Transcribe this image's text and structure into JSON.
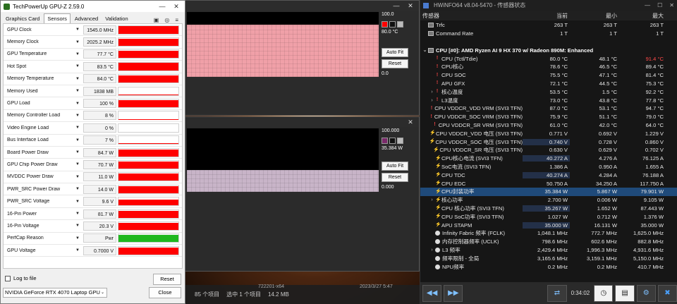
{
  "gpuz": {
    "title": "TechPowerUp GPU-Z 2.59.0",
    "tabs": [
      "Graphics Card",
      "Sensors",
      "Advanced",
      "Validation"
    ],
    "sensors": [
      {
        "name": "GPU Clock",
        "value": "1545.0 MHz",
        "level": 0.95,
        "color": "#ff0000"
      },
      {
        "name": "Memory Clock",
        "value": "2025.2 MHz",
        "level": 0.95,
        "color": "#ff0000"
      },
      {
        "name": "GPU Temperature",
        "value": "77.7 °C",
        "level": 0.95,
        "color": "#ff0000"
      },
      {
        "name": "Hot Spot",
        "value": "83.5 °C",
        "level": 0.95,
        "color": "#ff0000"
      },
      {
        "name": "Memory Temperature",
        "value": "84.0 °C",
        "level": 0.95,
        "color": "#ff0000"
      },
      {
        "name": "Memory Used",
        "value": "1838 MB",
        "level": 0.1,
        "color": "#ff0000"
      },
      {
        "name": "GPU Load",
        "value": "100 %",
        "level": 0.95,
        "color": "#ff0000"
      },
      {
        "name": "Memory Controller Load",
        "value": "8 %",
        "level": 0.08,
        "color": "#ff0000"
      },
      {
        "name": "Video Engine Load",
        "value": "0 %",
        "level": 0.0,
        "color": "#ff0000"
      },
      {
        "name": "Bus Interface Load",
        "value": "7 %",
        "level": 0.07,
        "color": "#ff0000"
      },
      {
        "name": "Board Power Draw",
        "value": "84.7 W",
        "level": 0.9,
        "color": "#ff0000"
      },
      {
        "name": "GPU Chip Power Draw",
        "value": "70.7 W",
        "level": 0.9,
        "color": "#ff0000"
      },
      {
        "name": "MVDDC Power Draw",
        "value": "11.0 W",
        "level": 0.9,
        "color": "#ff0000"
      },
      {
        "name": "PWR_SRC Power Draw",
        "value": "14.0 W",
        "level": 0.9,
        "color": "#ff0000"
      },
      {
        "name": "PWR_SRC Voltage",
        "value": "9.6 V",
        "level": 0.75,
        "color": "#ff0000"
      },
      {
        "name": "16-Pin Power",
        "value": "81.7 W",
        "level": 0.9,
        "color": "#ff0000"
      },
      {
        "name": "16-Pin Voltage",
        "value": "20.3 V",
        "level": 0.9,
        "color": "#ff0000"
      },
      {
        "name": "PerfCap Reason",
        "value": "Pwr",
        "level": 0.95,
        "color": "#1fb81f"
      },
      {
        "name": "GPU Voltage",
        "value": "0.7000 V",
        "level": 0.9,
        "color": "#ff0000"
      }
    ],
    "log_to_file": "Log to file",
    "reset": "Reset",
    "gpu_select": "NVIDIA GeForce RTX 4070 Laptop GPU",
    "close": "Close"
  },
  "graph1": {
    "max_label": "100.0",
    "cur_label": "80.0 °C",
    "min_label": "0.0",
    "auto_fit": "Auto Fit",
    "reset": "Reset",
    "fill_color": "#f0a0a8",
    "level": 0.8
  },
  "graph2": {
    "max_label": "100.000",
    "cur_label": "35.384 W",
    "min_label": "0.000",
    "auto_fit": "Auto Fit",
    "reset": "Reset",
    "fill_color": "#c8b4c8",
    "level": 0.35
  },
  "explorer": {
    "item_count": "85 个项目",
    "selection": "选中 1 个项目",
    "size": "14.2 MB",
    "filename": "722201-x64",
    "date": "2023/3/27 5:47"
  },
  "hwinfo": {
    "title": "HWiNFO64 v8.04-5470 - 传感器状态",
    "col_sensor": "传感器",
    "col_current": "当前",
    "col_min": "最小",
    "col_max": "最大",
    "rows": [
      {
        "icon": "chip",
        "exp": "",
        "indent": 0,
        "name": "Trfc",
        "cur": "263 T",
        "min": "263 T",
        "max": "263 T"
      },
      {
        "icon": "chip",
        "exp": "",
        "indent": 0,
        "name": "Command Rate",
        "cur": "1 T",
        "min": "1 T",
        "max": "1 T"
      },
      {
        "icon": "",
        "exp": "",
        "indent": 0,
        "name": "",
        "cur": "",
        "min": "",
        "max": ""
      },
      {
        "icon": "chip",
        "exp": "v",
        "indent": 0,
        "name": "CPU [#0]: AMD Ryzen AI 9 HX 370 w/ Radeon 890M: Enhanced",
        "cur": "",
        "min": "",
        "max": "",
        "group": true
      },
      {
        "icon": "temp",
        "exp": "",
        "indent": 1,
        "name": "CPU (Tctl/Tdie)",
        "cur": "80.0 °C",
        "min": "48.1 °C",
        "max": "91.4 °C",
        "maxred": true
      },
      {
        "icon": "temp",
        "exp": "",
        "indent": 1,
        "name": "CPU核心",
        "cur": "78.6 °C",
        "min": "46.5 °C",
        "max": "89.4 °C"
      },
      {
        "icon": "temp",
        "exp": "",
        "indent": 1,
        "name": "CPU SOC",
        "cur": "75.5 °C",
        "min": "47.1 °C",
        "max": "81.4 °C"
      },
      {
        "icon": "temp",
        "exp": "",
        "indent": 1,
        "name": "APU GFX",
        "cur": "72.1 °C",
        "min": "44.5 °C",
        "max": "75.3 °C"
      },
      {
        "icon": "temp",
        "exp": ">",
        "indent": 1,
        "name": "核心温度",
        "cur": "53.5 °C",
        "min": "1.5 °C",
        "max": "92.2 °C"
      },
      {
        "icon": "temp",
        "exp": ">",
        "indent": 1,
        "name": "L3温度",
        "cur": "73.0 °C",
        "min": "43.8 °C",
        "max": "77.8 °C"
      },
      {
        "icon": "temp",
        "exp": "",
        "indent": 1,
        "name": "CPU VDDCR_VDD VRM (SVI3 TFN)",
        "cur": "87.0 °C",
        "min": "53.1 °C",
        "max": "94.7 °C"
      },
      {
        "icon": "temp",
        "exp": "",
        "indent": 1,
        "name": "CPU VDDCR_SOC VRM (SVI3 TFN)",
        "cur": "75.9 °C",
        "min": "51.1 °C",
        "max": "79.0 °C"
      },
      {
        "icon": "temp",
        "exp": "",
        "indent": 1,
        "name": "CPU VDDCR_SR VRM (SVI3 TFN)",
        "cur": "61.0 °C",
        "min": "42.0 °C",
        "max": "64.0 °C"
      },
      {
        "icon": "volt",
        "exp": "",
        "indent": 1,
        "name": "CPU VDDCR_VDD 电压 (SVI3 TFN)",
        "cur": "0.771 V",
        "min": "0.692 V",
        "max": "1.229 V"
      },
      {
        "icon": "volt",
        "exp": "",
        "indent": 1,
        "name": "CPU VDDCR_SOC 电压 (SVI3 TFN)",
        "cur": "0.740 V",
        "min": "0.728 V",
        "max": "0.860 V",
        "shade": true
      },
      {
        "icon": "volt",
        "exp": "",
        "indent": 1,
        "name": "CPU VDDCR_SR 电压 (SVI3 TFN)",
        "cur": "0.630 V",
        "min": "0.629 V",
        "max": "0.702 V"
      },
      {
        "icon": "volt",
        "exp": "",
        "indent": 1,
        "name": "CPU核心电流 (SVI3 TFN)",
        "cur": "40.272 A",
        "min": "4.276 A",
        "max": "76.125 A",
        "shade": true
      },
      {
        "icon": "volt",
        "exp": "",
        "indent": 1,
        "name": "SoC电流 (SVI3 TFN)",
        "cur": "1.386 A",
        "min": "0.950 A",
        "max": "1.655 A"
      },
      {
        "icon": "volt",
        "exp": "",
        "indent": 1,
        "name": "CPU TDC",
        "cur": "40.274 A",
        "min": "4.284 A",
        "max": "76.188 A",
        "shade": true
      },
      {
        "icon": "volt",
        "exp": "",
        "indent": 1,
        "name": "CPU EDC",
        "cur": "50.750 A",
        "min": "34.250 A",
        "max": "117.750 A"
      },
      {
        "icon": "volt",
        "exp": "",
        "indent": 1,
        "name": "CPU封装功率",
        "cur": "35.384 W",
        "min": "5.867 W",
        "max": "79.901 W",
        "sel": true
      },
      {
        "icon": "volt",
        "exp": ">",
        "indent": 1,
        "name": "核心功率",
        "cur": "2.700 W",
        "min": "0.006 W",
        "max": "9.105 W"
      },
      {
        "icon": "volt",
        "exp": "",
        "indent": 1,
        "name": "CPU 核心功率 (SVI3 TFN)",
        "cur": "35.267 W",
        "min": "1.652 W",
        "max": "87.443 W",
        "shade": true
      },
      {
        "icon": "volt",
        "exp": "",
        "indent": 1,
        "name": "CPU SoC功率 (SVI3 TFN)",
        "cur": "1.027 W",
        "min": "0.712 W",
        "max": "1.376 W"
      },
      {
        "icon": "volt",
        "exp": "",
        "indent": 1,
        "name": "APU STAPM",
        "cur": "35.000 W",
        "min": "16.131 W",
        "max": "35.000 W",
        "shade": true
      },
      {
        "icon": "clock",
        "exp": "",
        "indent": 1,
        "name": "Infinity Fabric 频率 (FCLK)",
        "cur": "1,048.1 MHz",
        "min": "772.7 MHz",
        "max": "1,625.0 MHz"
      },
      {
        "icon": "clock",
        "exp": "",
        "indent": 1,
        "name": "内存控制器频率 (UCLK)",
        "cur": "798.6 MHz",
        "min": "602.6 MHz",
        "max": "882.8 MHz"
      },
      {
        "icon": "clock",
        "exp": ">",
        "indent": 1,
        "name": "L3 频率",
        "cur": "2,429.4 MHz",
        "min": "1,996.3 MHz",
        "max": "4,931.6 MHz"
      },
      {
        "icon": "clock",
        "exp": "",
        "indent": 1,
        "name": "频率限制 - 全局",
        "cur": "3,165.6 MHz",
        "min": "3,159.1 MHz",
        "max": "5,150.0 MHz"
      },
      {
        "icon": "clock",
        "exp": "",
        "indent": 1,
        "name": "NPU频率",
        "cur": "0.2 MHz",
        "min": "0.2 MHz",
        "max": "410.7 MHz"
      }
    ],
    "timer": "0:34:02",
    "nav_left": "◀◀",
    "nav_right": "▶▶"
  }
}
